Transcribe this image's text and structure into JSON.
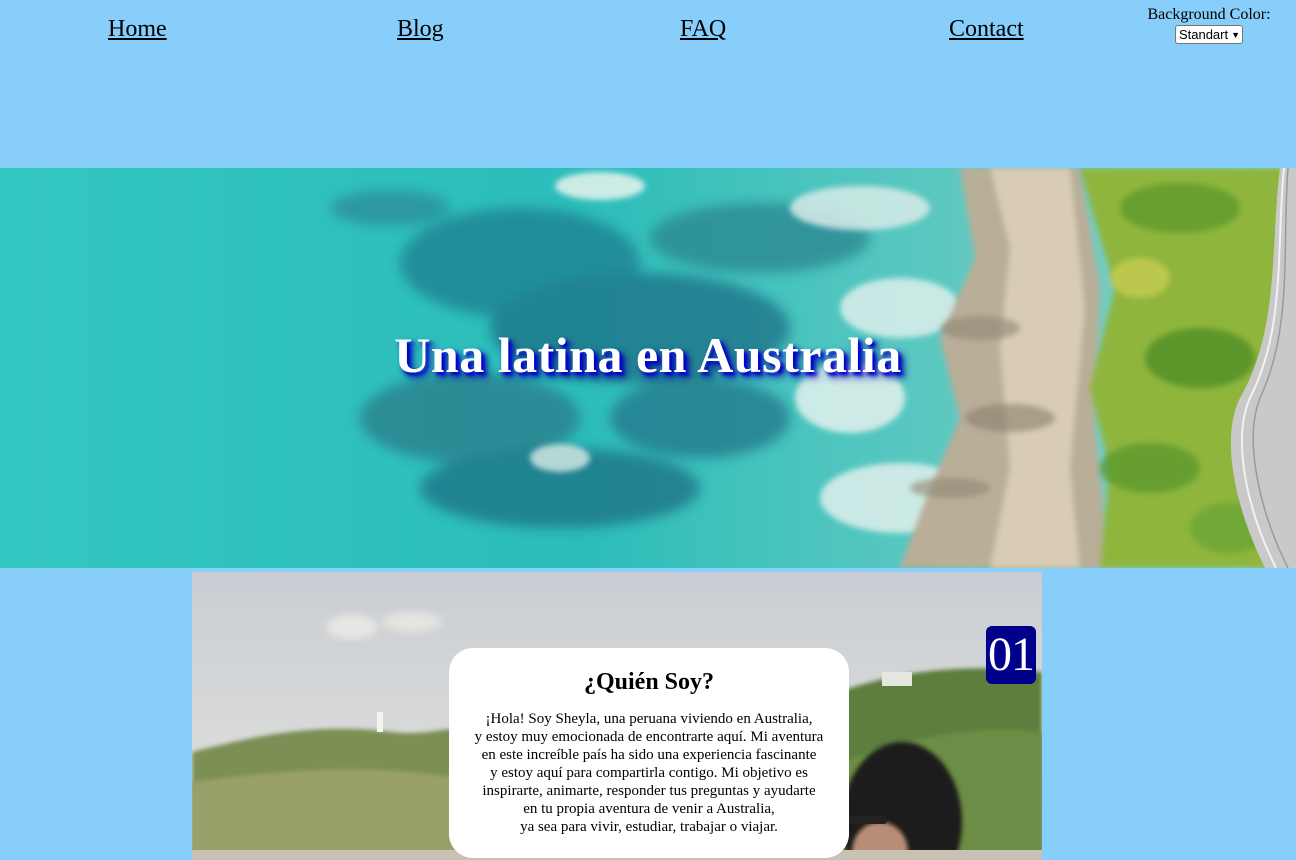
{
  "nav": {
    "links": [
      "Home",
      "Blog",
      "FAQ",
      "Contact"
    ],
    "background_color": {
      "label": "Background Color:",
      "selected": "Standart"
    }
  },
  "hero": {
    "title": "Una latina en Australia"
  },
  "about": {
    "badge": "01",
    "heading": "¿Quién Soy?",
    "body": "¡Hola! Soy Sheyla, una peruana viviendo en Australia,\ny estoy muy emocionada de encontrarte aquí. Mi aventura\nen este increíble país ha sido una experiencia fascinante\ny estoy aquí para compartirla contigo. Mi objetivo es\ninspirarte, animarte, responder tus preguntas y ayudarte\nen tu propia aventura de venir a Australia,\nya sea para vivir, estudiar, trabajar o viajar."
  },
  "colors": {
    "page_background": "#87cefa",
    "badge_background": "#00008b",
    "title_shadow": "#0000cd"
  }
}
